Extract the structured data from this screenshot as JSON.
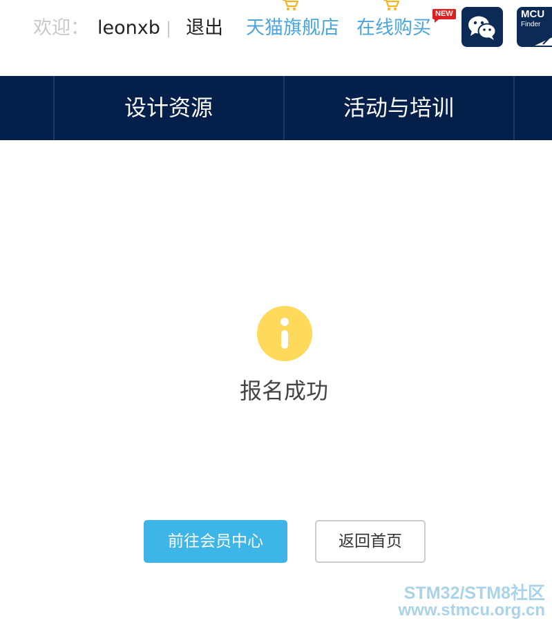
{
  "topbar": {
    "welcome_label": "欢迎：",
    "username": "leonxb",
    "separator": "|",
    "logout_label": "退出",
    "tmall_label": "天猫旗舰店",
    "buy_online_label": "在线购买",
    "new_badge": "NEW",
    "mcu_finder_title": "MCU",
    "mcu_finder_sub": "Finder",
    "icons": [
      "cart-icon",
      "wechat-icon",
      "mcu-finder-icon"
    ]
  },
  "nav": {
    "items": [
      {
        "label": "设计资源"
      },
      {
        "label": "活动与培训"
      }
    ]
  },
  "main": {
    "status_icon": "info-icon",
    "status_icon_color": "#ffd95c",
    "message": "报名成功",
    "buttons": {
      "member_center": "前往会员中心",
      "back_home": "返回首页"
    }
  },
  "watermark": {
    "line1": "STM32/STM8社区",
    "line2": "www.stmcu.org.cn"
  },
  "colors": {
    "nav_bg": "#04204a",
    "link": "#4aa6dc",
    "primary_button": "#3db5e6",
    "badge": "#e02020"
  }
}
